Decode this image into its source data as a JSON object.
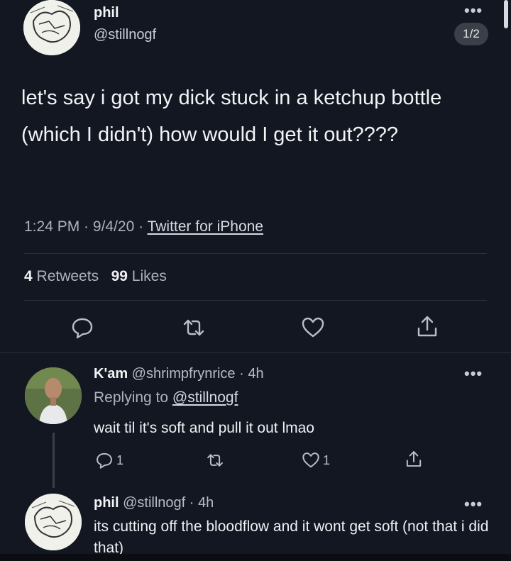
{
  "colors": {
    "background": "#131722",
    "text": "#e6e9ee",
    "muted": "#aeb3ba",
    "divider": "#2b303a"
  },
  "tweet": {
    "author_name": "phil",
    "author_handle": "@stillnogf",
    "more_icon": "more-dots-icon",
    "thread_counter": "1/2",
    "text": "let's say i got my dick stuck in a ketchup bottle (which I didn't) how would I get it out????",
    "time": "1:24 PM",
    "date": "9/4/20",
    "source": "Twitter for iPhone",
    "retweet_count": "4",
    "retweet_label": "Retweets",
    "like_count": "99",
    "like_label": "Likes",
    "actions": [
      "reply-icon",
      "retweet-icon",
      "like-icon",
      "share-icon"
    ]
  },
  "replies": [
    {
      "name": "K'am",
      "handle": "@shrimpfrynrice",
      "time": "4h",
      "replying_to_label": "Replying to",
      "replying_to": "@stillnogf",
      "text": "wait til it's soft and pull it out lmao",
      "reply_count": "1",
      "like_count": "1"
    },
    {
      "name": "phil",
      "handle": "@stillnogf",
      "time": "4h",
      "text": "its cutting off the bloodflow and it wont get soft (not that i did that)"
    }
  ]
}
